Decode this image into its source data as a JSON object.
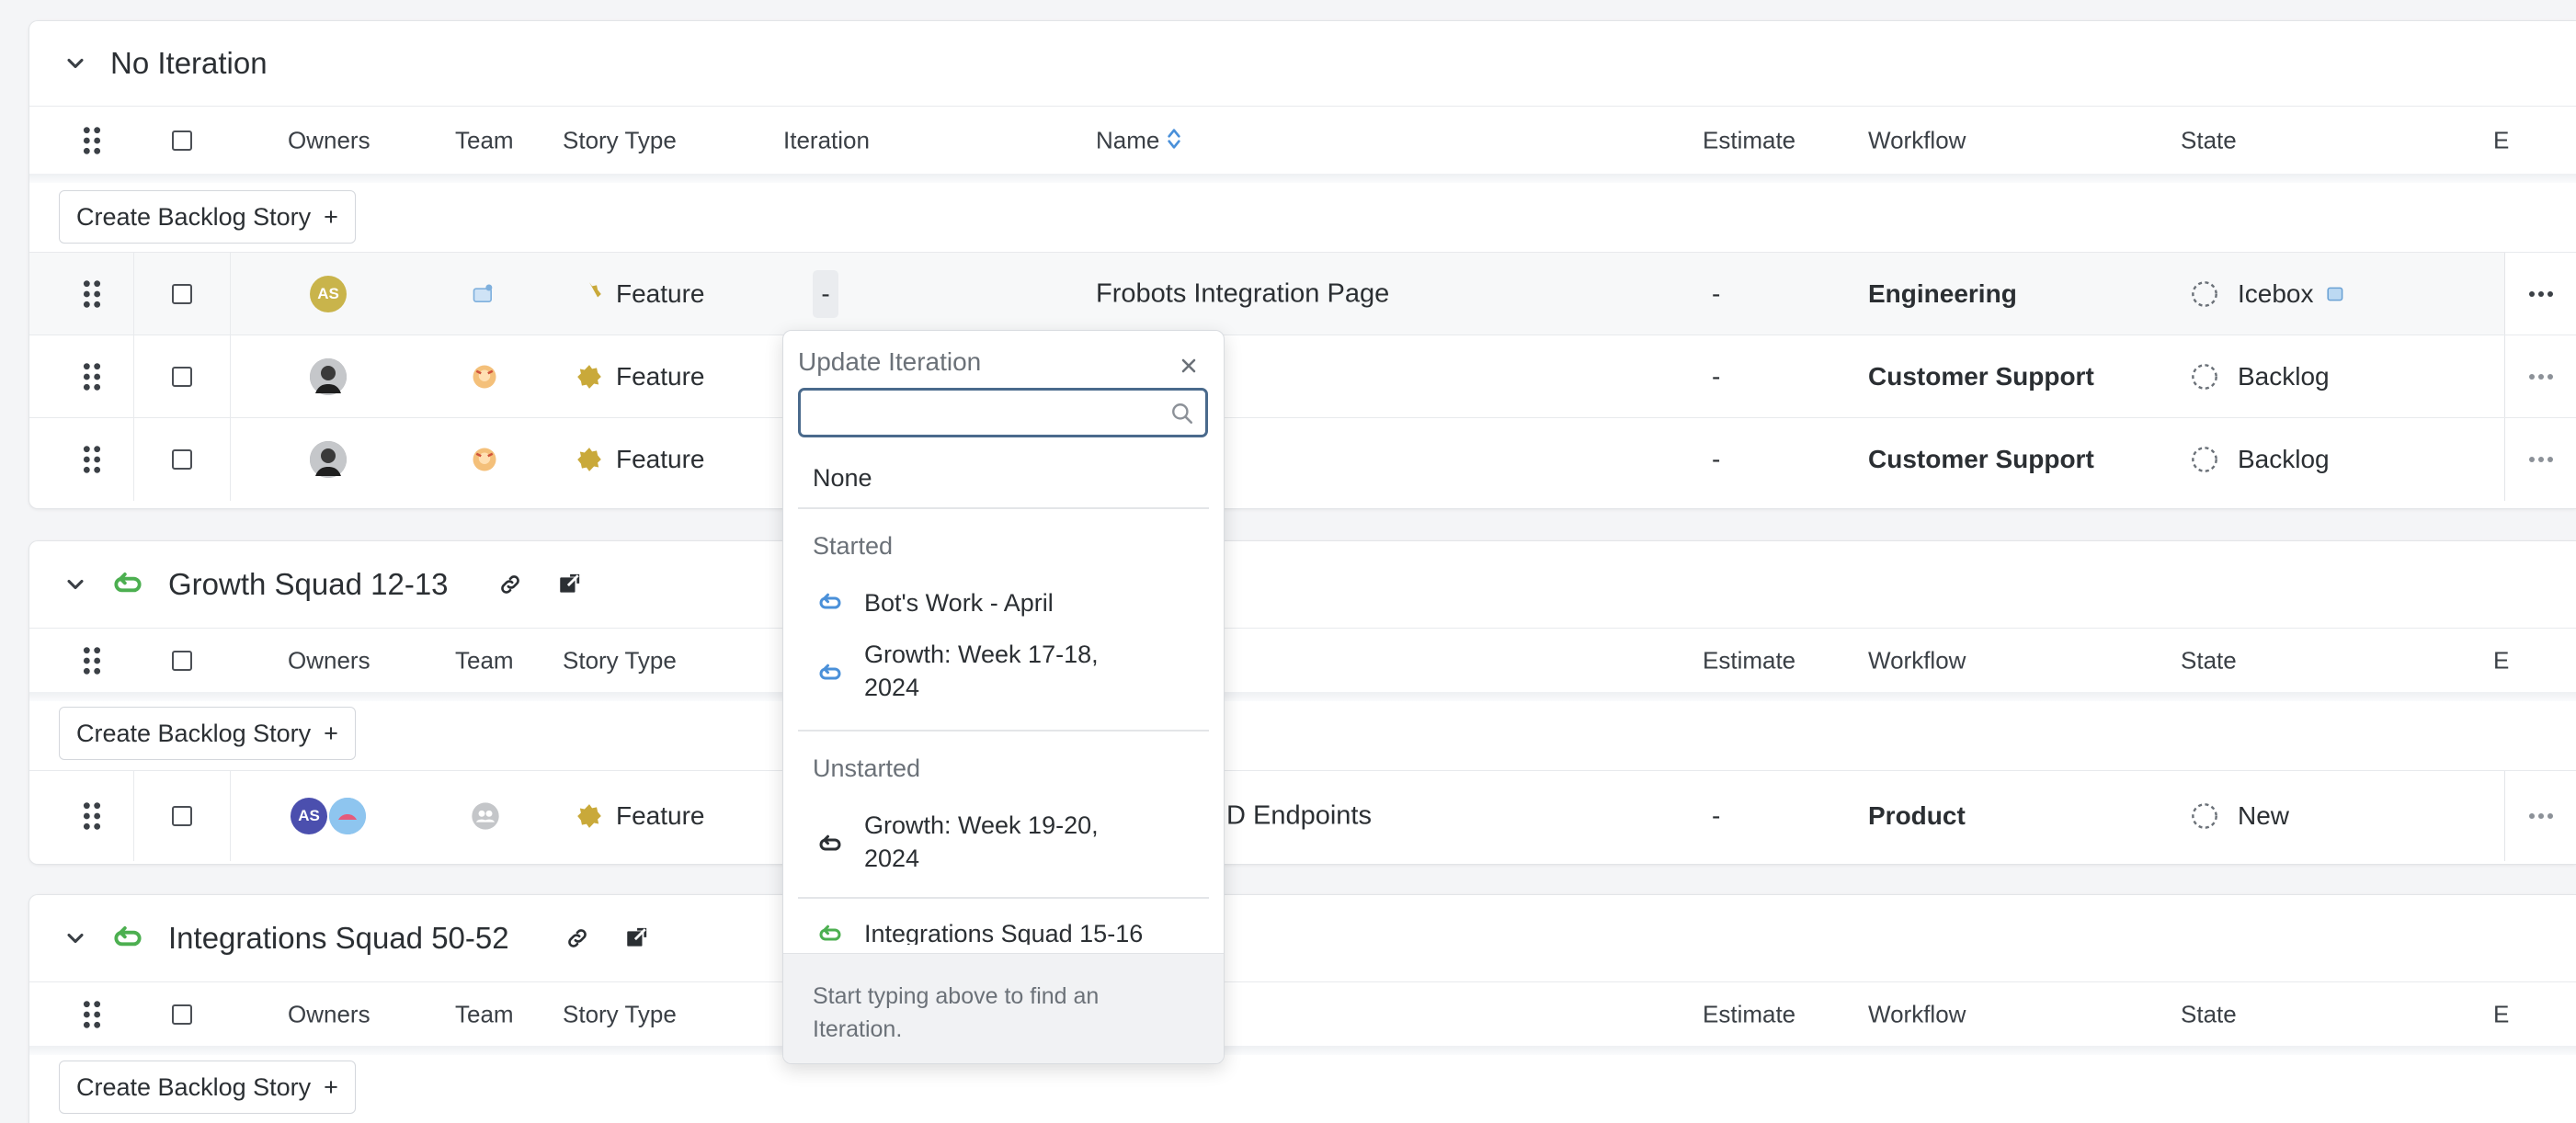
{
  "columns": {
    "owners": "Owners",
    "team": "Team",
    "story_type": "Story Type",
    "iteration": "Iteration",
    "name": "Name",
    "estimate": "Estimate",
    "workflow": "Workflow",
    "state": "State",
    "e_truncated": "E"
  },
  "create_button_label": "Create Backlog Story",
  "create_button_plus": "+",
  "sections": [
    {
      "title": "No Iteration",
      "rows": [
        {
          "owner_initials": "AS",
          "story_type": "Feature",
          "iteration": "-",
          "name": "Frobots Integration Page",
          "estimate": "-",
          "workflow": "Engineering",
          "state": "Icebox"
        },
        {
          "story_type": "Feature",
          "estimate": "-",
          "workflow": "Customer Support",
          "state": "Backlog"
        },
        {
          "story_type": "Feature",
          "estimate": "-",
          "workflow": "Customer Support",
          "state": "Backlog"
        }
      ]
    },
    {
      "title": "Growth Squad 12-13",
      "rows": [
        {
          "owner_initials": "AS",
          "story_type": "Feature",
          "name_visible": "D Endpoints",
          "estimate": "-",
          "workflow": "Product",
          "state": "New"
        }
      ]
    },
    {
      "title": "Integrations Squad 50-52"
    }
  ],
  "dropdown": {
    "title": "Update Iteration",
    "close_symbol": "×",
    "none_label": "None",
    "groups": [
      {
        "label": "Started",
        "items": [
          "Bot's Work - April",
          "Growth: Week 17-18, 2024"
        ]
      },
      {
        "label": "Unstarted",
        "items": [
          "Growth: Week 19-20, 2024"
        ]
      }
    ],
    "partial_item": "Integrations Squad 15-16",
    "footer": "Start typing above to find an Iteration."
  },
  "colors": {
    "accent_green": "#4caf50",
    "iteration_blue": "#4a90d9",
    "feature_gold": "#c9a93a",
    "avatar_gold": "#c9b44b",
    "avatar_indigo": "#4b4fae"
  }
}
